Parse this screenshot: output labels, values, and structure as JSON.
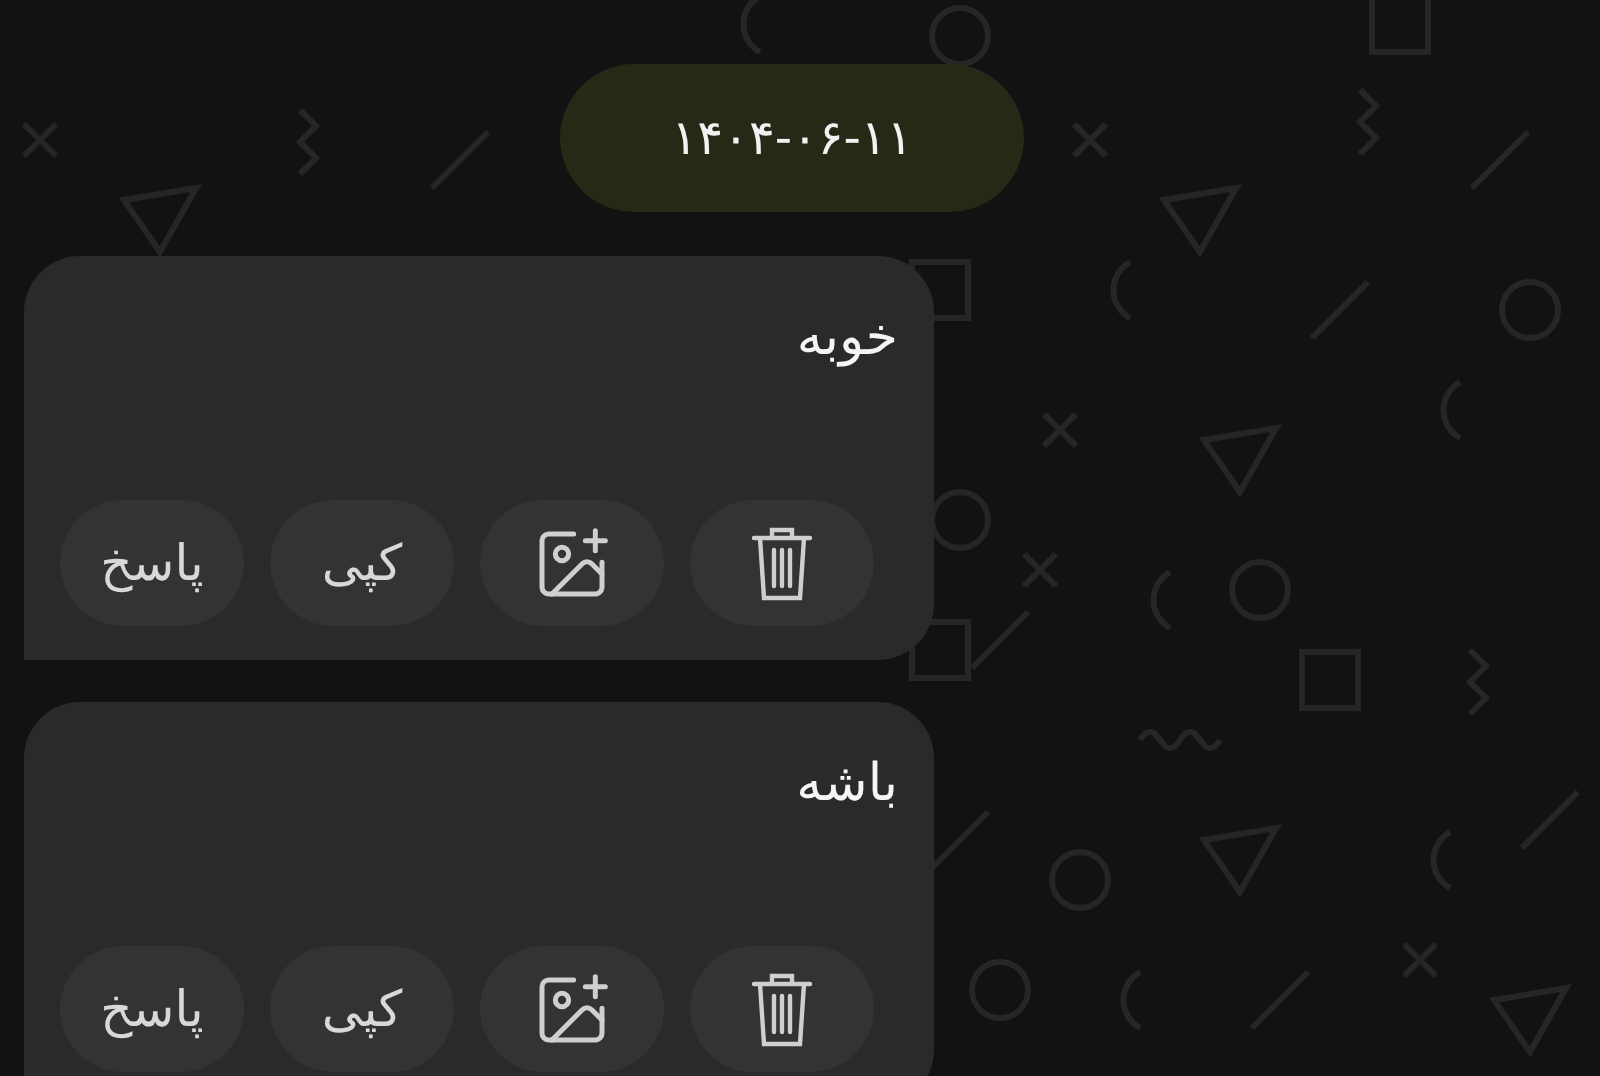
{
  "date": "۱۴۰۴-۰۶-۱۱",
  "messages": [
    {
      "text": "خوبه",
      "actions": [
        {
          "kind": "delete"
        },
        {
          "kind": "image-add"
        },
        {
          "kind": "text",
          "label": "کپی"
        },
        {
          "kind": "text",
          "label": "پاسخ"
        }
      ]
    },
    {
      "text": "باشه",
      "actions": [
        {
          "kind": "delete"
        },
        {
          "kind": "image-add"
        },
        {
          "kind": "text",
          "label": "کپی"
        },
        {
          "kind": "text",
          "label": "پاسخ"
        }
      ]
    }
  ]
}
